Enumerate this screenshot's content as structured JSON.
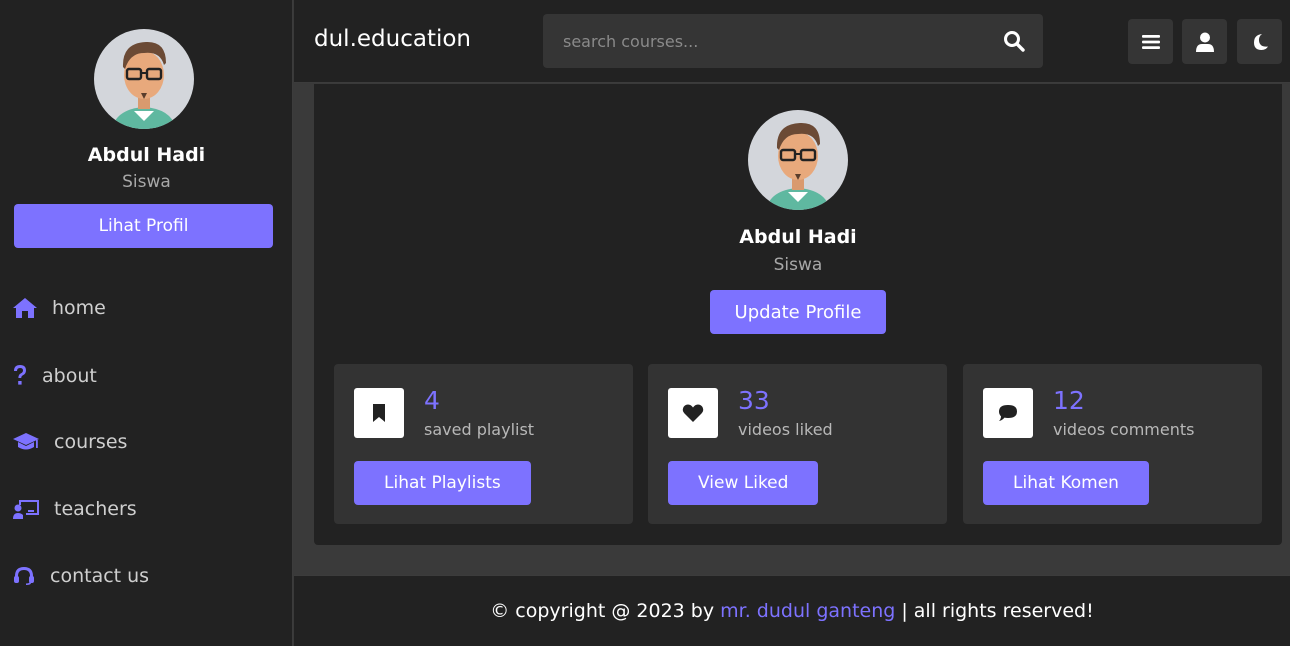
{
  "sidebar": {
    "user": {
      "name": "Abdul Hadi",
      "role": "Siswa"
    },
    "profile_button": "Lihat Profil",
    "nav": [
      {
        "label": "home",
        "icon": "home-icon"
      },
      {
        "label": "about",
        "icon": "question-icon"
      },
      {
        "label": "courses",
        "icon": "graduation-cap-icon"
      },
      {
        "label": "teachers",
        "icon": "chalkboard-teacher-icon"
      },
      {
        "label": "contact us",
        "icon": "headset-icon"
      }
    ]
  },
  "header": {
    "logo": "dul.education",
    "search": {
      "placeholder": "search courses..."
    },
    "buttons": [
      "menu-icon",
      "user-icon",
      "moon-icon"
    ]
  },
  "profile": {
    "name": "Abdul Hadi",
    "role": "Siswa",
    "update_button": "Update Profile"
  },
  "stats": [
    {
      "icon": "bookmark-icon",
      "count": "4",
      "label": "saved playlist",
      "button": "Lihat Playlists"
    },
    {
      "icon": "heart-icon",
      "count": "33",
      "label": "videos liked",
      "button": "View Liked"
    },
    {
      "icon": "comment-icon",
      "count": "12",
      "label": "videos comments",
      "button": "Lihat Komen"
    }
  ],
  "footer": {
    "prefix": "© copyright @ 2023 by ",
    "author": "mr. dudul ganteng",
    "suffix": " | all rights reserved!"
  },
  "colors": {
    "accent": "#7d72ff",
    "panel": "#222222",
    "card": "#333333",
    "background": "#3a3a3a"
  }
}
